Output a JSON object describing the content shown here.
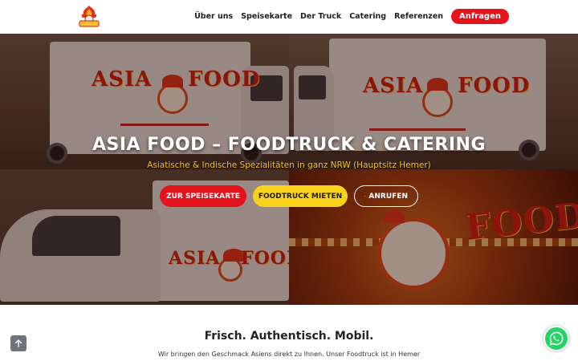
{
  "header": {
    "logo_alt": "Asia Food logo",
    "nav": [
      {
        "label": "Über uns"
      },
      {
        "label": "Speisekarte"
      },
      {
        "label": "Der Truck"
      },
      {
        "label": "Catering"
      },
      {
        "label": "Referenzen"
      }
    ],
    "cta_label": "Anfragen"
  },
  "hero": {
    "brand_word_1": "ASIA",
    "brand_word_2": "FOOD",
    "title": "ASIA FOOD – FOODTRUCK & CATERING",
    "subtitle": "Asiatische & Indische Spezialitäten in ganz NRW (Hauptsitz Hemer)",
    "buttons": {
      "menu": "ZUR SPEISEKARTE",
      "rent": "FOODTRUCK MIETEN",
      "call": "ANRUFEN"
    }
  },
  "intro": {
    "title": "Frisch. Authentisch. Mobil.",
    "text": "Wir bringen den Geschmack Asiens direkt zu Ihnen. Unser Foodtruck ist in Hemer"
  },
  "floating": {
    "to_top_icon": "arrow-up-icon",
    "whatsapp_icon": "whatsapp-icon"
  },
  "colors": {
    "accent_red": "#e3121b",
    "accent_yellow": "#f9d21b",
    "whatsapp_green": "#25d366"
  }
}
